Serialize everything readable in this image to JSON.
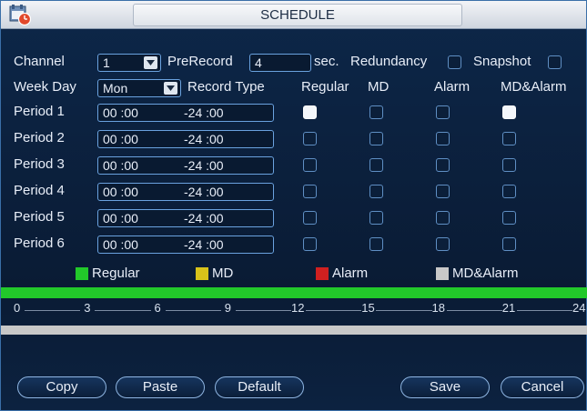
{
  "window": {
    "title": "SCHEDULE"
  },
  "row1": {
    "channel_label": "Channel",
    "channel_value": "1",
    "prerecord_label": "PreRecord",
    "prerecord_value": "4",
    "sec_label": "sec.",
    "redundancy_label": "Redundancy",
    "redundancy_checked": false,
    "snapshot_label": "Snapshot",
    "snapshot_checked": false
  },
  "row2": {
    "weekday_label": "Week Day",
    "weekday_value": "Mon",
    "record_type_label": "Record Type",
    "col_regular": "Regular",
    "col_md": "MD",
    "col_alarm": "Alarm",
    "col_mdalarm": "MD&Alarm"
  },
  "periods": [
    {
      "label": "Period 1",
      "start": "00 :00",
      "end": "-24 :00",
      "regular": true,
      "md": false,
      "alarm": false,
      "mdalarm": true
    },
    {
      "label": "Period 2",
      "start": "00 :00",
      "end": "-24 :00",
      "regular": false,
      "md": false,
      "alarm": false,
      "mdalarm": false
    },
    {
      "label": "Period 3",
      "start": "00 :00",
      "end": "-24 :00",
      "regular": false,
      "md": false,
      "alarm": false,
      "mdalarm": false
    },
    {
      "label": "Period 4",
      "start": "00 :00",
      "end": "-24 :00",
      "regular": false,
      "md": false,
      "alarm": false,
      "mdalarm": false
    },
    {
      "label": "Period 5",
      "start": "00 :00",
      "end": "-24 :00",
      "regular": false,
      "md": false,
      "alarm": false,
      "mdalarm": false
    },
    {
      "label": "Period 6",
      "start": "00 :00",
      "end": "-24 :00",
      "regular": false,
      "md": false,
      "alarm": false,
      "mdalarm": false
    }
  ],
  "legend": {
    "regular": {
      "label": "Regular",
      "color": "#22c92a"
    },
    "md": {
      "label": "MD",
      "color": "#d8c21a"
    },
    "alarm": {
      "label": "Alarm",
      "color": "#d02020"
    },
    "mdalarm": {
      "label": "MD&Alarm",
      "color": "#c8c8c8"
    }
  },
  "timeline": {
    "ticks": [
      "0",
      "3",
      "6",
      "9",
      "12",
      "15",
      "18",
      "21",
      "24"
    ],
    "regular_bar_color": "#22c92a",
    "mdalarm_bar_color": "#c8c8c8"
  },
  "buttons": {
    "copy": "Copy",
    "paste": "Paste",
    "default": "Default",
    "save": "Save",
    "cancel": "Cancel"
  }
}
